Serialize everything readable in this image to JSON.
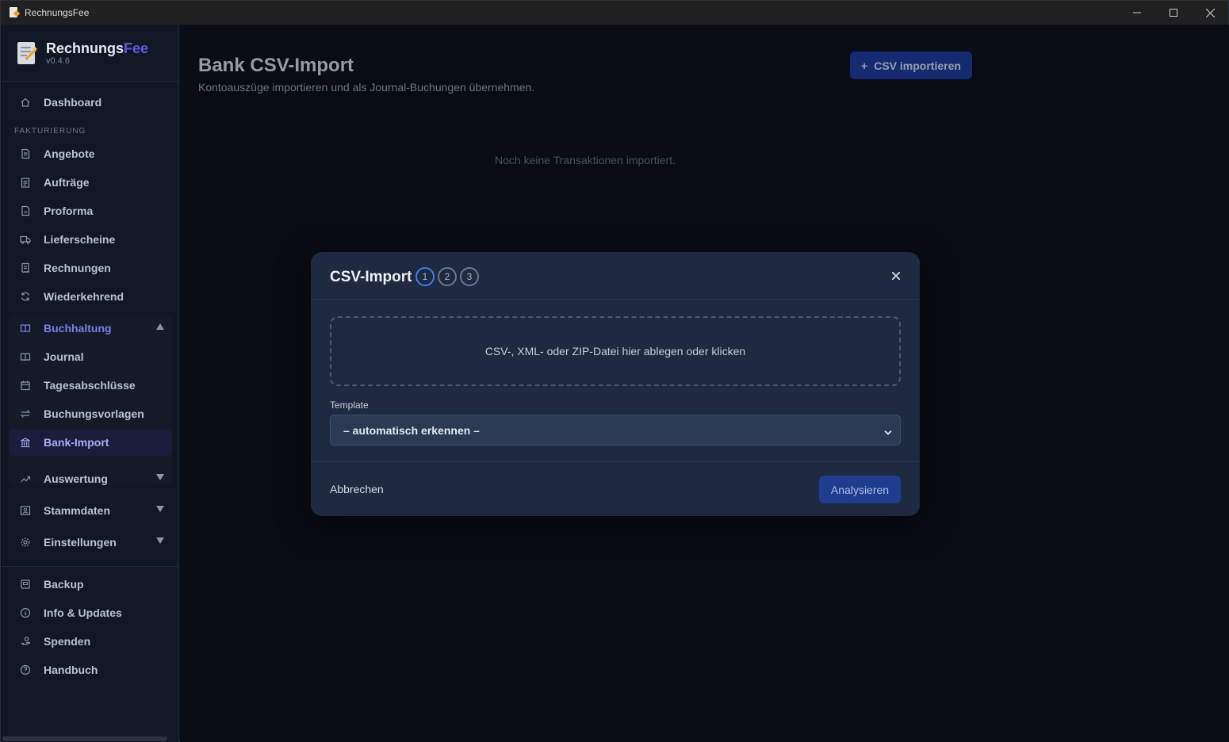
{
  "window": {
    "title": "RechnungsFee"
  },
  "brand": {
    "name_main": "Rechnungs",
    "name_accent": "Fee",
    "version": "v0.4.6"
  },
  "sidebar": {
    "dashboard": "Dashboard",
    "section_billing": "FAKTURIERUNG",
    "billing_items": [
      "Angebote",
      "Aufträge",
      "Proforma",
      "Lieferscheine",
      "Rechnungen",
      "Wiederkehrend"
    ],
    "accounting": "Buchhaltung",
    "accounting_items": [
      "Journal",
      "Tagesabschlüsse",
      "Buchungsvorlagen",
      "Bank-Import"
    ],
    "collapsed_sections": [
      "Auswertung",
      "Stammdaten",
      "Einstellungen"
    ],
    "footer_items": [
      "Backup",
      "Info & Updates",
      "Spenden",
      "Handbuch"
    ]
  },
  "main": {
    "title": "Bank CSV-Import",
    "subtitle": "Kontoauszüge importieren und als Journal-Buchungen übernehmen.",
    "import_button": "CSV importieren",
    "empty_state": "Noch keine Transaktionen importiert."
  },
  "modal": {
    "title": "CSV-Import",
    "steps": [
      "1",
      "2",
      "3"
    ],
    "active_step": 1,
    "dropzone_text": "CSV-, XML- oder ZIP-Datei hier ablegen oder klicken",
    "template_label": "Template",
    "template_value": "– automatisch erkennen –",
    "cancel": "Abbrechen",
    "analyze": "Analysieren"
  },
  "colors": {
    "accent": "#1d3ea8",
    "brand_accent": "#5b5be0",
    "step_active": "#3f7df0"
  }
}
